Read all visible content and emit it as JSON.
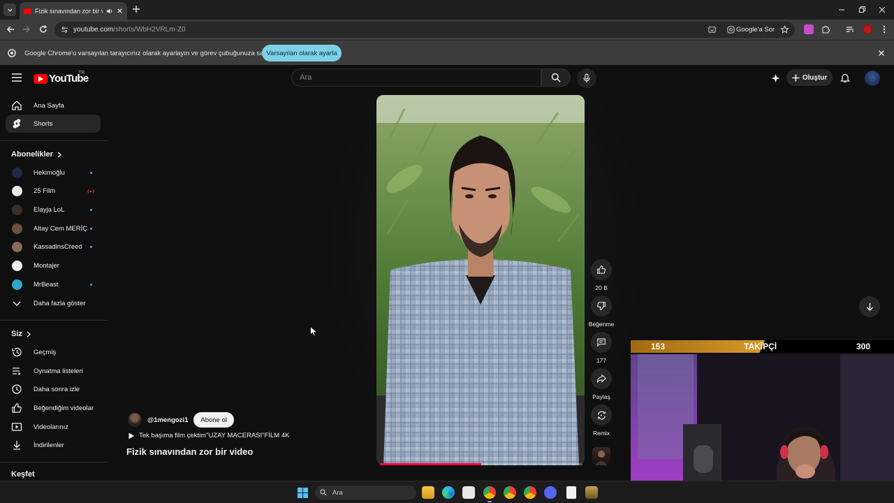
{
  "browser": {
    "tab_title": "Fizik sınavından zor bir video",
    "url_host": "youtube.com",
    "url_path": "/shorts/WbH2VRLm-Z0",
    "google_sor": "Google'a Sor"
  },
  "infobar": {
    "message": "Google Chrome'u varsayılan tarayıcınız olarak ayarlayın ve görev çubuğunuza sabitleyin",
    "button": "Varsayılan olarak ayarla"
  },
  "header": {
    "logo_text": "YouTube",
    "region": "TR",
    "search_placeholder": "Ara",
    "create_label": "Oluştur"
  },
  "sidebar": {
    "main": [
      {
        "label": "Ana Sayfa",
        "icon": "home-icon"
      },
      {
        "label": "Shorts",
        "icon": "shorts-icon",
        "active": true
      }
    ],
    "subs_title": "Abonelikler",
    "subscriptions": [
      {
        "label": "Hekimoğlu",
        "indicator": "dot",
        "avatar_color": "#1d2b4a"
      },
      {
        "label": "25 Film",
        "indicator": "live",
        "avatar_color": "#e8e8e8"
      },
      {
        "label": "Elayja LoL",
        "indicator": "dot",
        "avatar_color": "#3b2f2a"
      },
      {
        "label": "Altay Cem MERİÇ",
        "indicator": "dot",
        "avatar_color": "#6e4f40"
      },
      {
        "label": "KassadinsCreed",
        "indicator": "dot",
        "avatar_color": "#8a6a58"
      },
      {
        "label": "Montajer",
        "indicator": "none",
        "avatar_color": "#f1f1f1"
      },
      {
        "label": "MrBeast",
        "indicator": "dot",
        "avatar_color": "#2fa5c9"
      }
    ],
    "show_more": "Daha fazla göster",
    "you_title": "Siz",
    "you": [
      {
        "label": "Geçmiş",
        "icon": "history-icon"
      },
      {
        "label": "Oynatma listeleri",
        "icon": "playlists-icon"
      },
      {
        "label": "Daha sonra izle",
        "icon": "watch-later-icon"
      },
      {
        "label": "Beğendiğim videolar",
        "icon": "liked-icon"
      },
      {
        "label": "Videolarınız",
        "icon": "your-videos-icon"
      },
      {
        "label": "İndirilenler",
        "icon": "downloads-icon"
      }
    ],
    "explore_title": "Keşfet"
  },
  "short": {
    "channel": "@1mengozi1",
    "subscribe": "Abone ol",
    "music": "Tek başıma film çektim\"UZAY MACERASI\"FİLM 4K",
    "title": "Fizik sınavından zor bir video",
    "progress_fraction": 0.5
  },
  "actions": {
    "like_count": "20 B",
    "dislike": "Beğenme",
    "comments": "177",
    "share": "Paylaş",
    "remix": "Remix"
  },
  "overlay": {
    "followers_current": "153",
    "followers_label": "TAKİPÇİ",
    "followers_goal": "300",
    "fraction": 0.51
  },
  "taskbar": {
    "search": "Ara"
  }
}
